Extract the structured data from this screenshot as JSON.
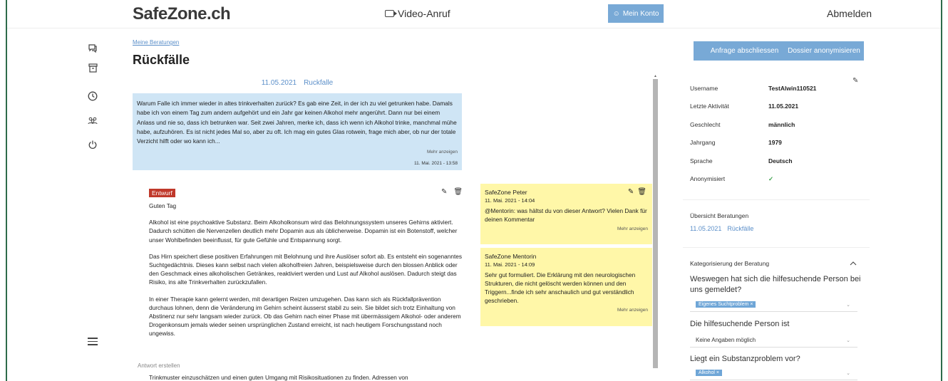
{
  "header": {
    "logo": "SafeZone.ch",
    "video_call": "Video-Anruf",
    "my_account": "Mein Konto",
    "logout": "Abmelden"
  },
  "breadcrumb": "Meine Beratungen",
  "page_title": "Rückfälle",
  "thread": {
    "date": "11.05.2021",
    "topic": "Ruckfalle",
    "question": "Warum Falle ich immer wieder in altes trinkverhalten zurück? Es gab eine Zeit, in der ich zu viel getrunken habe. Damals habe ich von einem Tag zum andern aufgehört und ein Jahr gar keinen Alkohol mehr angerührt. Dann nur bei einem Anlass und nie so, dass ich betrunken war. Seit zwei Jahren, merke ich, dass ich wenn ich Alkohol trinke, manchmal mühe habe, aufzuhören. Es ist nicht jedes Mal so, aber zu oft. Ich mag ein gutes Glas rotwein, frage mich aber, ob nur der totale Verzicht hilft oder wo kann ich...",
    "show_more": "Mehr anzeigen",
    "timestamp": "11. Mai. 2021 - 13:58"
  },
  "draft": {
    "badge": "Entwurf",
    "greeting": "Guten Tag",
    "p1": "Alkohol ist eine psychoaktive Substanz. Beim Alkoholkonsum wird das Belohnungssystem unseres Gehirns aktiviert. Dadurch schütten die Nervenzellen deutlich mehr Dopamin aus als üblicherweise. Dopamin ist ein Botenstoff, welcher unser Wohlbefinden beeinflusst, für gute Gefühle und Entspannung sorgt.",
    "p2": "Das Hirn speichert diese positiven Erfahrungen mit Belohnung und ihre Auslöser sofort ab. Es entsteht ein sogenanntes Suchtgedächtnis. Dieses kann selbst nach vielen alkoholfreien Jahren, beispielsweise durch den blossen Anblick oder den Geschmack eines alkoholischen Getränkes, reaktiviert werden und Lust auf Alkohol auslösen. Dadurch steigt das Risiko, ins alte Trinkverhalten zurückzufallen.",
    "p3": "In einer Therapie kann gelernt werden, mit derartigen Reizen umzugehen. Das kann sich als Rückfallprävention durchaus lohnen, denn die Veränderung im Gehirn scheint äusserst stabil zu sein. Sie bildet sich trotz Einhaltung von Abstinenz nur sehr langsam wieder zurück. Ob das Gehirn nach einer Phase mit übermässigem Alkohol- oder anderem Drogenkonsum jemals wieder seinen ursprünglichen Zustand erreicht, ist nach heutigem Forschungsstand noch ungewiss.",
    "create_label": "Antwort erstellen",
    "p4": "Trinkmuster einzuschätzen und einen guten Umgang mit Risikosituationen zu finden. Adressen von"
  },
  "comments": [
    {
      "author": "SafeZone Peter",
      "time": "11. Mai. 2021 - 14:04",
      "text": "@Mentorin: was hältst du von dieser Antwort? Vielen Dank für deinen Kommentar",
      "more": "Mehr anzeigen"
    },
    {
      "author": "SafeZone Mentorin",
      "time": "11. Mai. 2021 - 14:09",
      "text": "Sehr gut formuliert. Die Erklärung mit den neurologischen Strukturen, die nicht gelöscht werden können und den Triggern...finde ich sehr anschaulich und gut verständlich geschrieben.",
      "more": "Mehr anzeigen"
    }
  ],
  "actions": {
    "close_request": "Anfrage abschliessen",
    "anonymize": "Dossier anonymisieren"
  },
  "profile": {
    "username_label": "Username",
    "username": "TestAlwin110521",
    "activity_label": "Letzte Aktivität",
    "activity": "11.05.2021",
    "gender_label": "Geschlecht",
    "gender": "männlich",
    "year_label": "Jahrgang",
    "year": "1979",
    "language_label": "Sprache",
    "language": "Deutsch",
    "anon_label": "Anonymisiert",
    "anon": "✓"
  },
  "overview": {
    "label": "Übersicht Beratungen",
    "date": "11.05.2021",
    "topic": "Rückfälle"
  },
  "categorization": {
    "title": "Kategorisierung der Beratung",
    "q1": "Weswegen hat sich die hilfesuchende Person bei uns gemeldet?",
    "q1_tag": "Eigenes Suchtproblem ×",
    "q2": "Die hilfesuchende Person ist",
    "q2_value": "Keine Angaben möglich",
    "q3": "Liegt ein Substanzproblem vor?",
    "q3_tag": "Alkohol ×"
  },
  "colors": {
    "accent": "#78a9d6",
    "link": "#5b8fc9",
    "question_bg": "#cfe5f5",
    "comment_bg": "#fff7a8",
    "draft_badge": "#c0392b"
  }
}
